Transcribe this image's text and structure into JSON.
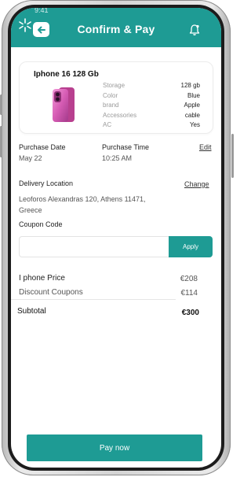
{
  "status": {
    "time": "9:41"
  },
  "header": {
    "title": "Confirm & Pay"
  },
  "product": {
    "name": "Iphone 16 128 Gb",
    "specs": [
      {
        "label": "Storage",
        "value": "128 gb"
      },
      {
        "label": "Color",
        "value": "Blue"
      },
      {
        "label": "brand",
        "value": "Apple"
      },
      {
        "label": "Accessories",
        "value": "cable"
      },
      {
        "label": "AC",
        "value": "Yes"
      }
    ]
  },
  "purchase": {
    "date_label": "Purchase Date",
    "date_value": "May 22",
    "time_label": "Purchase Time",
    "time_value": "10:25 AM",
    "edit_label": "Edit"
  },
  "delivery": {
    "label": "Delivery Location",
    "change_label": "Change",
    "address_line1": "Leoforos Alexandras 120, Athens 11471,",
    "address_line2": "Greece"
  },
  "coupon": {
    "label": "Coupon Code",
    "input_value": "",
    "apply_label": "Apply"
  },
  "summary": {
    "price_label": "I phone Price",
    "price_value": "€208",
    "discount_label": "Discount Coupons",
    "discount_value": "€114",
    "subtotal_label": "Subtotal",
    "subtotal_value": "€300"
  },
  "pay_button": {
    "label": "Pay now"
  },
  "colors": {
    "accent": "#1e9b94"
  }
}
